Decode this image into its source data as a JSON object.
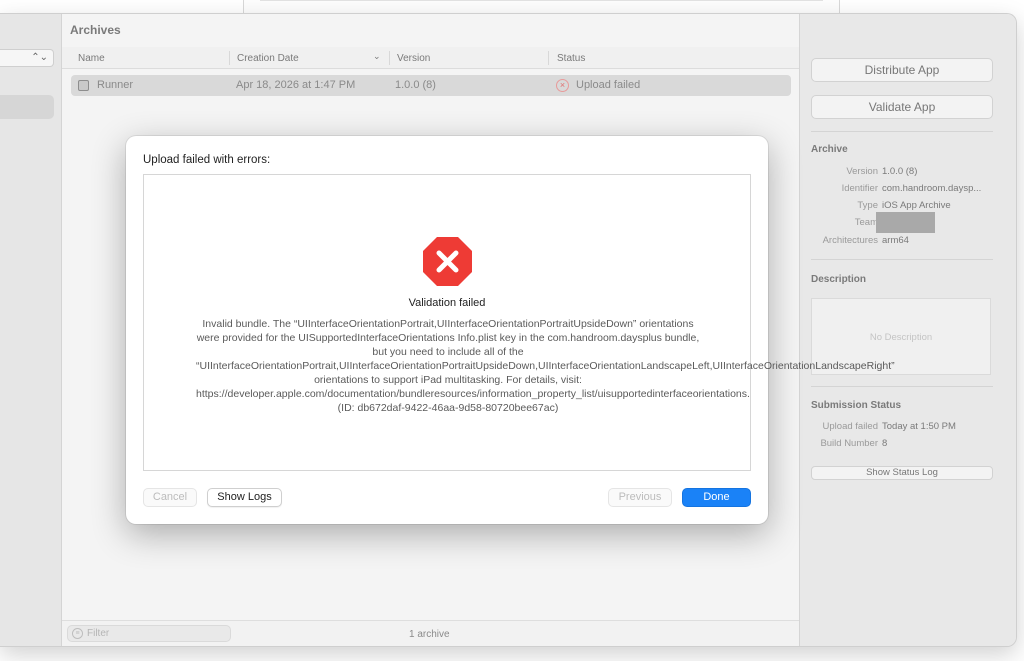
{
  "archives": {
    "title": "Archives",
    "columns": [
      "Name",
      "Creation Date",
      "Version",
      "Status"
    ],
    "rows": [
      {
        "name": "Runner",
        "date": "Apr 18, 2026 at 1:47 PM",
        "version": "1.0.0 (8)",
        "status": "Upload failed"
      }
    ],
    "filter_placeholder": "Filter",
    "count": "1 archive"
  },
  "right_panel": {
    "distribute": "Distribute App",
    "validate": "Validate App",
    "archive_heading": "Archive",
    "archive_info": [
      {
        "key": "Version",
        "value": "1.0.0 (8)"
      },
      {
        "key": "Identifier",
        "value": "com.handroom.daysp..."
      },
      {
        "key": "Type",
        "value": "iOS App Archive"
      },
      {
        "key": "Team",
        "value": ""
      },
      {
        "key": "Architectures",
        "value": "arm64"
      }
    ],
    "description_heading": "Description",
    "description_placeholder": "No Description",
    "submission_heading": "Submission Status",
    "submission_info": [
      {
        "key": "Upload failed",
        "value": "Today at 1:50 PM"
      },
      {
        "key": "Build Number",
        "value": "8"
      }
    ],
    "show_status_log": "Show Status Log"
  },
  "dialog": {
    "title": "Upload failed with errors:",
    "headline": "Validation failed",
    "message": "Invalid bundle. The “UIInterfaceOrientationPortrait,UIInterfaceOrientationPortraitUpsideDown” orientations were provided for the UISupportedInterfaceOrientations Info.plist key in the com.handroom.daysplus bundle, but you need to include all of the “UIInterfaceOrientationPortrait,UIInterfaceOrientationPortraitUpsideDown,UIInterfaceOrientationLandscapeLeft,UIInterfaceOrientationLandscapeRight” orientations to support iPad multitasking. For details, visit: https://developer.apple.com/documentation/bundleresources/information_property_list/uisupportedinterfaceorientations. (ID: db672daf-9422-46aa-9d58-80720bee67ac)",
    "cancel": "Cancel",
    "show_logs": "Show Logs",
    "previous": "Previous",
    "done": "Done",
    "error_color": "#ee3b35",
    "accent": "#1a82f7"
  }
}
